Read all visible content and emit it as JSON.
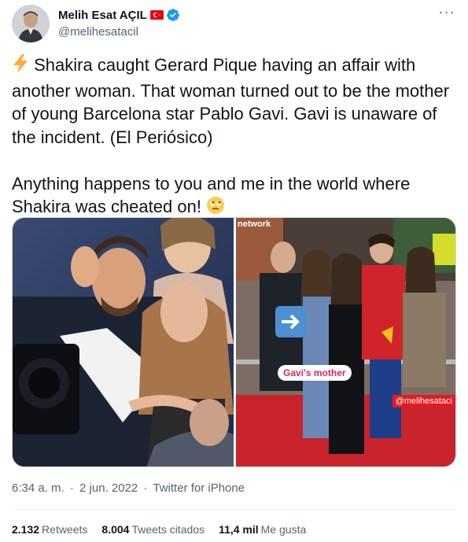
{
  "author": {
    "display_name": "Melih Esat AÇIL",
    "handle": "@melihesatacil",
    "flag_icon": "turkey-flag-icon",
    "verified_icon": "verified-badge-icon"
  },
  "more_icon": "more-options-icon",
  "tweet": {
    "lead_emoji": "⚡",
    "paragraph1": "Shakira caught Gerard Pique having an affair with another woman. That woman turned out to be the mother of young Barcelona star Pablo Gavi. Gavi is unaware of the incident. (El Periósico)",
    "paragraph2": "Anything happens to you and me in the world where Shakira was cheated on!",
    "trail_emoji": "🙄"
  },
  "media": {
    "right_caption": "Gavi's mother",
    "right_watermark": "@melihesataci",
    "right_brand": "network"
  },
  "meta": {
    "time": "6:34 a. m.",
    "separator": "·",
    "date": "2 jun. 2022",
    "source": "Twitter for iPhone"
  },
  "stats": {
    "retweets_count": "2.132",
    "retweets_label": "Retweets",
    "quotes_count": "8.004",
    "quotes_label": "Tweets citados",
    "likes_count": "11,4 mil",
    "likes_label": "Me gusta"
  }
}
